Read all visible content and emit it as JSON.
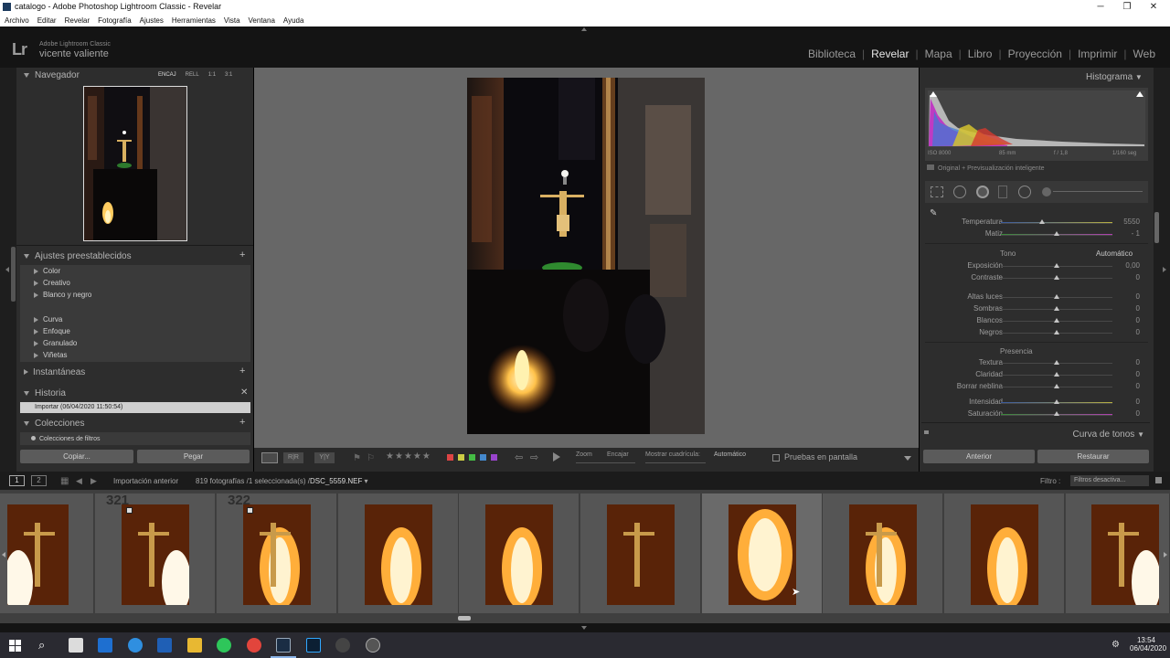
{
  "window": {
    "title": "catalogo - Adobe Photoshop Lightroom Classic - Revelar"
  },
  "menu": [
    "Archivo",
    "Editar",
    "Revelar",
    "Fotografía",
    "Ajustes",
    "Herramientas",
    "Vista",
    "Ventana",
    "Ayuda"
  ],
  "brand": {
    "logo": "Lr",
    "product": "Adobe Lightroom Classic",
    "user": "vicente valiente"
  },
  "modules": [
    {
      "label": "Biblioteca",
      "active": false
    },
    {
      "label": "Revelar",
      "active": true
    },
    {
      "label": "Mapa",
      "active": false
    },
    {
      "label": "Libro",
      "active": false
    },
    {
      "label": "Proyección",
      "active": false
    },
    {
      "label": "Imprimir",
      "active": false
    },
    {
      "label": "Web",
      "active": false
    }
  ],
  "navigator": {
    "title": "Navegador",
    "zoom_options": [
      "ENCAJ",
      "RELL",
      "1:1",
      "3:1"
    ]
  },
  "presets": {
    "title": "Ajustes preestablecidos",
    "groups_a": [
      "Color",
      "Creativo",
      "Blanco y negro"
    ],
    "groups_b": [
      "Curva",
      "Enfoque",
      "Granulado",
      "Viñetas"
    ]
  },
  "snapshots": {
    "title": "Instantáneas"
  },
  "history": {
    "title": "Historia",
    "items": [
      "Importar (06/04/2020 11:50:54)"
    ]
  },
  "collections": {
    "title": "Colecciones",
    "items": [
      "Colecciones de filtros"
    ]
  },
  "left_buttons": {
    "copy": "Copiar...",
    "paste": "Pegar"
  },
  "histogram": {
    "title": "Histograma",
    "info": [
      "ISO 8000",
      "85 mm",
      "f / 1,8",
      "1/160 seg"
    ],
    "preview": "Original + Previsualización inteligente"
  },
  "basic": {
    "wb": [
      {
        "label": "Temperatura",
        "value": "5550",
        "pos": 0.37
      },
      {
        "label": "Matiz",
        "value": "- 1",
        "pos": 0.5
      }
    ],
    "tone_label": "Tono",
    "auto_label": "Automático",
    "tone": [
      {
        "label": "Exposición",
        "value": "0,00",
        "pos": 0.5
      },
      {
        "label": "Contraste",
        "value": "0",
        "pos": 0.5
      }
    ],
    "tone2": [
      {
        "label": "Altas luces",
        "value": "0",
        "pos": 0.5
      },
      {
        "label": "Sombras",
        "value": "0",
        "pos": 0.5
      },
      {
        "label": "Blancos",
        "value": "0",
        "pos": 0.5
      },
      {
        "label": "Negros",
        "value": "0",
        "pos": 0.5
      }
    ],
    "presence_label": "Presencia",
    "presence": [
      {
        "label": "Textura",
        "value": "0",
        "pos": 0.5
      },
      {
        "label": "Claridad",
        "value": "0",
        "pos": 0.5
      },
      {
        "label": "Borrar neblina",
        "value": "0",
        "pos": 0.5
      }
    ],
    "presence2": [
      {
        "label": "Intensidad",
        "value": "0",
        "pos": 0.5
      },
      {
        "label": "Saturación",
        "value": "0",
        "pos": 0.5
      }
    ]
  },
  "tone_curve": {
    "title": "Curva de tonos"
  },
  "right_buttons": {
    "previous": "Anterior",
    "reset": "Restaurar"
  },
  "toolbar": {
    "stars": 5,
    "zoom_label": "Zoom",
    "fit_label": "Encajar",
    "grid_label": "Mostrar cuadrícula:",
    "grid_value": "Automático",
    "softproof_label": "Pruebas en pantalla"
  },
  "filmbar": {
    "pages": [
      "1",
      "2"
    ],
    "source": "Importación anterior",
    "count": "819 fotografías /1 seleccionada(s) /",
    "filename": "DSC_5559.NEF",
    "filter_label": "Filtro :",
    "filter_value": "Filtros desactiva..."
  },
  "filmstrip": {
    "numbers": [
      "321",
      "322"
    ]
  },
  "clock": {
    "time": "13:54",
    "date": "06/04/2020"
  }
}
